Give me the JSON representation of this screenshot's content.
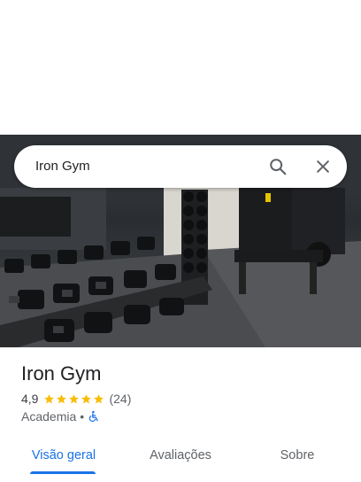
{
  "search": {
    "query": "Iron Gym"
  },
  "place": {
    "name": "Iron Gym",
    "rating": "4,9",
    "stars": 5,
    "review_count": "(24)",
    "category": "Academia",
    "separator": "•"
  },
  "tabs": [
    {
      "label": "Visão geral",
      "active": true
    },
    {
      "label": "Avaliações",
      "active": false
    },
    {
      "label": "Sobre",
      "active": false
    }
  ],
  "colors": {
    "accent": "#1a73e8",
    "star": "#fbbc04",
    "text_secondary": "#5f6368"
  },
  "icons": [
    "search-icon",
    "close-icon",
    "star-icon",
    "wheelchair-icon"
  ]
}
